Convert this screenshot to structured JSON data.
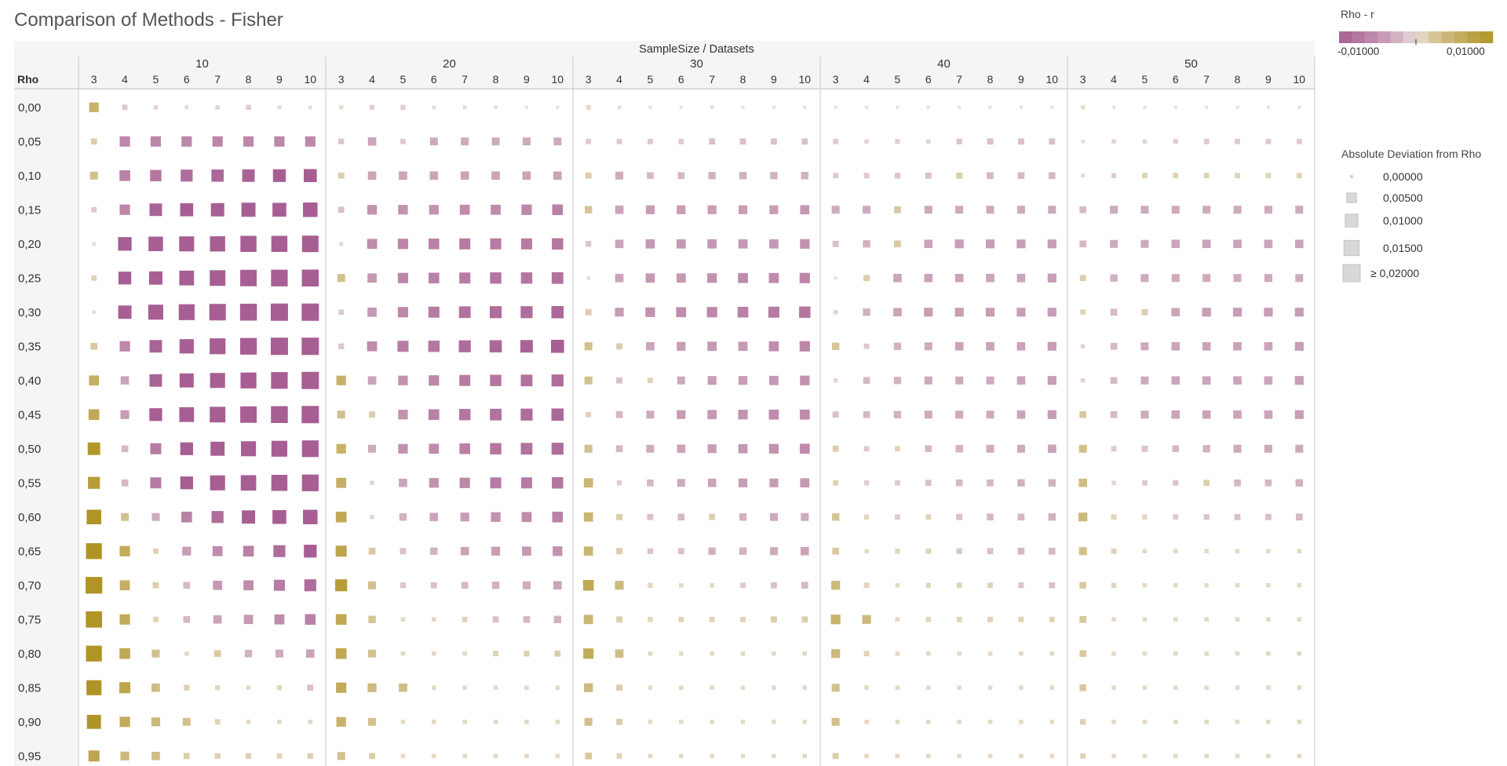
{
  "title": "Comparison of Methods - Fisher",
  "chart_data": {
    "type": "heatmap",
    "title": "Comparison of Methods - Fisher",
    "column_header": "SampleSize  /  Datasets",
    "row_header": "Rho",
    "sample_sizes": [
      "10",
      "20",
      "30",
      "40",
      "50"
    ],
    "datasets": [
      "3",
      "4",
      "5",
      "6",
      "7",
      "8",
      "9",
      "10"
    ],
    "rho": [
      "0,00",
      "0,05",
      "0,10",
      "0,15",
      "0,20",
      "0,25",
      "0,30",
      "0,35",
      "0,40",
      "0,45",
      "0,50",
      "0,55",
      "0,60",
      "0,65",
      "0,70",
      "0,75",
      "0,80",
      "0,85",
      "0,90",
      "0,95"
    ],
    "color_encoding": "Rho - r (signed)",
    "size_encoding": "Absolute Deviation from Rho",
    "note": "Each cell value = Rho - r; square size = |value|",
    "values": [
      [
        0.005,
        -0.001,
        -0.0005,
        -0.0003,
        -0.0005,
        -0.0008,
        -0.0003,
        -0.0002,
        0.0004,
        -0.0007,
        -0.0008,
        -0.0002,
        -0.0003,
        -0.0002,
        -0.0001,
        -0.0001,
        0.0006,
        -0.0002,
        -0.0001,
        -0.0001,
        -0.0002,
        -0.0001,
        -0.0001,
        -0.0001,
        -0.0001,
        -0.0001,
        -0.0001,
        -0.0001,
        -0.0001,
        -0.0001,
        -0.0001,
        -0.0001,
        0.0004,
        -0.0001,
        -0.0001,
        -0.0001,
        -0.0001,
        -0.0001,
        -0.0001,
        -0.0001
      ],
      [
        0.0015,
        -0.006,
        -0.006,
        -0.006,
        -0.006,
        -0.006,
        -0.006,
        -0.006,
        -0.0012,
        -0.0035,
        -0.001,
        -0.003,
        -0.003,
        -0.003,
        -0.003,
        -0.003,
        -0.001,
        -0.001,
        -0.001,
        -0.001,
        -0.0015,
        -0.0015,
        -0.0015,
        -0.0015,
        -0.001,
        -0.0005,
        -0.0007,
        -0.0005,
        -0.0012,
        -0.0015,
        -0.0015,
        -0.0015,
        -0.0002,
        -0.0005,
        -0.0005,
        -0.0007,
        -0.001,
        -0.001,
        -0.001,
        -0.001
      ],
      [
        0.003,
        -0.0065,
        -0.0075,
        -0.0085,
        -0.009,
        -0.0095,
        -0.01,
        -0.0105,
        0.0015,
        -0.0035,
        -0.0035,
        -0.0035,
        -0.0035,
        -0.0035,
        -0.0035,
        -0.0035,
        0.0015,
        -0.003,
        -0.002,
        -0.002,
        -0.0025,
        -0.0025,
        -0.0025,
        -0.0025,
        -0.001,
        -0.001,
        -0.0012,
        -0.0015,
        0.0015,
        -0.002,
        -0.002,
        -0.002,
        -0.0003,
        -0.0008,
        0.001,
        0.001,
        0.001,
        0.001,
        0.001,
        0.001
      ],
      [
        -0.001,
        -0.006,
        -0.0095,
        -0.0105,
        -0.011,
        -0.0125,
        -0.012,
        -0.0135,
        -0.0015,
        -0.005,
        -0.005,
        -0.005,
        -0.0055,
        -0.0055,
        -0.006,
        -0.0065,
        0.0025,
        -0.0035,
        -0.004,
        -0.004,
        -0.004,
        -0.004,
        -0.004,
        -0.0045,
        -0.003,
        -0.003,
        0.002,
        -0.003,
        -0.003,
        -0.003,
        -0.003,
        -0.003,
        -0.002,
        -0.003,
        -0.003,
        -0.003,
        -0.003,
        -0.003,
        -0.003,
        -0.003
      ],
      [
        -0.0002,
        -0.0115,
        -0.0135,
        -0.0145,
        -0.015,
        -0.017,
        -0.017,
        -0.018,
        -0.0003,
        -0.0055,
        -0.006,
        -0.0065,
        -0.007,
        -0.007,
        -0.007,
        -0.0075,
        -0.0012,
        -0.0035,
        -0.0045,
        -0.0045,
        -0.0045,
        -0.0045,
        -0.0045,
        -0.005,
        -0.0015,
        -0.0025,
        0.002,
        -0.0035,
        -0.004,
        -0.004,
        -0.004,
        -0.004,
        -0.002,
        -0.003,
        -0.003,
        -0.0035,
        -0.0035,
        -0.0035,
        -0.0035,
        -0.0035
      ],
      [
        0.001,
        -0.01,
        -0.011,
        -0.014,
        -0.016,
        -0.018,
        -0.0185,
        -0.019,
        0.003,
        -0.0045,
        -0.006,
        -0.0065,
        -0.007,
        -0.0075,
        -0.0075,
        -0.008,
        -0.0002,
        -0.0035,
        -0.0045,
        -0.0045,
        -0.005,
        -0.0055,
        -0.0055,
        -0.006,
        -0.0001,
        0.0015,
        -0.0035,
        -0.0035,
        -0.0035,
        -0.0035,
        -0.0035,
        -0.004,
        0.0015,
        -0.0025,
        -0.003,
        -0.003,
        -0.003,
        -0.003,
        -0.003,
        -0.003
      ],
      [
        -0.0002,
        -0.011,
        -0.0145,
        -0.0165,
        -0.018,
        -0.019,
        -0.02,
        -0.021,
        -0.001,
        -0.0045,
        -0.006,
        -0.007,
        -0.008,
        -0.0085,
        -0.0085,
        -0.009,
        0.0015,
        -0.004,
        -0.005,
        -0.0055,
        -0.006,
        -0.0065,
        -0.007,
        -0.0075,
        -0.0005,
        -0.0025,
        -0.0035,
        -0.004,
        -0.004,
        -0.004,
        -0.004,
        -0.004,
        0.001,
        -0.002,
        0.0015,
        -0.0035,
        -0.004,
        -0.004,
        -0.004,
        -0.004
      ],
      [
        0.002,
        -0.006,
        -0.0095,
        -0.013,
        -0.0165,
        -0.0185,
        -0.0205,
        -0.021,
        -0.0012,
        -0.0055,
        -0.007,
        -0.0075,
        -0.0085,
        -0.009,
        -0.0095,
        -0.0105,
        0.003,
        0.0015,
        -0.0035,
        -0.004,
        -0.0045,
        -0.0045,
        -0.0055,
        -0.006,
        0.0025,
        -0.001,
        -0.0025,
        -0.003,
        -0.0035,
        -0.0035,
        -0.0035,
        -0.004,
        -0.0005,
        -0.002,
        -0.003,
        -0.0035,
        -0.0035,
        -0.0035,
        -0.0035,
        -0.004
      ],
      [
        0.0055,
        -0.0035,
        -0.0095,
        -0.0125,
        -0.0145,
        -0.0165,
        -0.0185,
        -0.02,
        0.005,
        -0.0035,
        -0.005,
        -0.006,
        -0.007,
        -0.0075,
        -0.008,
        -0.0085,
        0.003,
        -0.0015,
        0.001,
        -0.003,
        -0.004,
        -0.004,
        -0.0045,
        -0.005,
        -0.0005,
        -0.002,
        -0.0025,
        -0.003,
        -0.003,
        -0.003,
        -0.0035,
        -0.004,
        -0.0005,
        -0.002,
        -0.003,
        -0.0035,
        -0.0035,
        -0.0035,
        -0.0035,
        -0.004
      ],
      [
        0.0065,
        -0.004,
        -0.01,
        -0.014,
        -0.016,
        -0.018,
        -0.019,
        -0.021,
        0.003,
        0.0015,
        -0.005,
        -0.0065,
        -0.0075,
        -0.008,
        -0.0085,
        -0.009,
        0.001,
        -0.002,
        -0.003,
        -0.004,
        -0.0045,
        -0.005,
        -0.0055,
        -0.0055,
        -0.0015,
        -0.002,
        -0.0025,
        -0.003,
        -0.003,
        -0.003,
        -0.0035,
        -0.004,
        0.002,
        -0.002,
        -0.003,
        -0.0035,
        -0.0035,
        -0.0035,
        -0.0035,
        -0.004
      ],
      [
        0.0095,
        -0.002,
        -0.007,
        -0.01,
        -0.0125,
        -0.0145,
        -0.0165,
        -0.0185,
        0.005,
        -0.003,
        -0.005,
        -0.0055,
        -0.0065,
        -0.0075,
        -0.008,
        -0.0085,
        0.003,
        -0.002,
        -0.003,
        -0.0035,
        -0.004,
        -0.0045,
        -0.005,
        -0.0055,
        0.0015,
        -0.001,
        0.001,
        -0.002,
        -0.0025,
        -0.003,
        -0.003,
        -0.0035,
        0.003,
        -0.001,
        -0.0015,
        -0.002,
        -0.0025,
        -0.003,
        -0.003,
        -0.003
      ],
      [
        0.0085,
        -0.002,
        -0.007,
        -0.01,
        -0.0145,
        -0.0155,
        -0.017,
        -0.0185,
        0.0055,
        -0.0005,
        -0.0035,
        -0.005,
        -0.006,
        -0.007,
        -0.007,
        -0.0075,
        0.0045,
        -0.0008,
        -0.002,
        -0.003,
        -0.0035,
        -0.004,
        -0.004,
        -0.0045,
        0.001,
        -0.0008,
        -0.001,
        -0.0015,
        -0.002,
        -0.002,
        -0.0025,
        -0.0025,
        0.0035,
        -0.0005,
        -0.001,
        -0.0012,
        0.0015,
        -0.002,
        -0.002,
        -0.0025
      ],
      [
        0.0135,
        0.003,
        -0.003,
        -0.0065,
        -0.0085,
        -0.011,
        -0.012,
        -0.0135,
        0.0065,
        -0.0005,
        -0.0025,
        -0.0035,
        -0.004,
        -0.005,
        -0.0055,
        -0.0065,
        0.0045,
        0.0015,
        -0.0015,
        -0.002,
        0.0015,
        -0.0025,
        -0.003,
        -0.003,
        0.0025,
        0.0008,
        -0.001,
        0.001,
        -0.0015,
        -0.002,
        -0.002,
        -0.0025,
        0.004,
        0.001,
        0.0008,
        -0.001,
        -0.0012,
        -0.0015,
        -0.0015,
        -0.002
      ],
      [
        0.0165,
        0.006,
        0.001,
        -0.004,
        -0.0055,
        -0.0065,
        -0.0085,
        -0.01,
        0.007,
        0.002,
        -0.0015,
        -0.0025,
        -0.0035,
        -0.004,
        -0.0045,
        -0.005,
        0.0045,
        0.0015,
        -0.0012,
        -0.0015,
        -0.0025,
        -0.0025,
        -0.003,
        -0.0035,
        0.002,
        0.0005,
        0.0008,
        0.001,
        -0.0012,
        -0.0015,
        -0.002,
        -0.002,
        0.003,
        0.001,
        0.0005,
        0.0005,
        0.0005,
        0.0005,
        0.0005,
        0.0005
      ],
      [
        0.0185,
        0.0055,
        0.0015,
        -0.002,
        -0.0045,
        -0.0055,
        -0.007,
        -0.0085,
        0.0085,
        0.003,
        -0.0012,
        -0.0015,
        -0.002,
        -0.0025,
        -0.003,
        -0.0035,
        0.0065,
        0.004,
        0.0008,
        0.0005,
        0.0005,
        -0.001,
        -0.0015,
        -0.002,
        0.004,
        0.001,
        0.0005,
        0.0008,
        0.001,
        0.001,
        -0.0012,
        -0.0015,
        0.002,
        0.0008,
        0.0005,
        0.0005,
        0.0005,
        0.0005,
        0.0005,
        0.0005
      ],
      [
        0.0175,
        0.006,
        0.001,
        -0.002,
        -0.0035,
        -0.0045,
        -0.0055,
        -0.0065,
        0.0065,
        0.0025,
        0.0005,
        0.0005,
        0.001,
        -0.0015,
        -0.002,
        -0.0025,
        0.0045,
        0.0015,
        0.0008,
        0.001,
        0.001,
        0.001,
        0.0015,
        0.0015,
        0.005,
        0.004,
        0.0005,
        0.0008,
        0.001,
        0.001,
        0.001,
        0.001,
        0.002,
        0.0005,
        0.0005,
        0.0005,
        0.0005,
        0.0005,
        0.0005,
        0.0005
      ],
      [
        0.0165,
        0.0065,
        0.003,
        0.0005,
        0.002,
        -0.0025,
        -0.003,
        -0.0035,
        0.0065,
        0.003,
        0.0005,
        0.0005,
        0.0005,
        0.001,
        0.0012,
        0.0015,
        0.006,
        0.0035,
        0.0005,
        0.0005,
        0.0005,
        0.0005,
        0.0005,
        0.0005,
        0.004,
        0.001,
        0.0005,
        0.0005,
        0.0005,
        0.0005,
        0.0005,
        0.0005,
        0.002,
        0.0005,
        0.0005,
        0.0005,
        0.0005,
        0.0005,
        0.0005,
        0.0005
      ],
      [
        0.0145,
        0.007,
        0.0035,
        0.0012,
        0.0008,
        0.0005,
        0.0008,
        -0.0015,
        0.006,
        0.004,
        0.0035,
        0.0005,
        0.0005,
        0.0005,
        0.0005,
        0.0005,
        0.004,
        0.0015,
        0.0005,
        0.0005,
        0.0005,
        0.0005,
        0.0005,
        0.0005,
        0.003,
        0.0005,
        0.0005,
        0.0005,
        0.0005,
        0.0005,
        0.0005,
        0.0005,
        0.002,
        0.0005,
        0.0005,
        0.0005,
        0.0005,
        0.0005,
        0.0005,
        0.0005
      ],
      [
        0.0125,
        0.006,
        0.004,
        0.003,
        0.001,
        0.0005,
        0.0005,
        0.0005,
        0.005,
        0.003,
        0.0005,
        0.0005,
        0.0005,
        0.0005,
        0.0005,
        0.0005,
        0.003,
        0.0015,
        0.0005,
        0.0005,
        0.0005,
        0.0005,
        0.0005,
        0.0005,
        0.003,
        0.0005,
        0.0005,
        0.0005,
        0.0005,
        0.0005,
        0.0005,
        0.0005,
        0.0012,
        0.0005,
        0.0005,
        0.0005,
        0.0005,
        0.0005,
        0.0005,
        0.0005
      ],
      [
        0.007,
        0.004,
        0.0035,
        0.0015,
        0.0012,
        0.0012,
        0.001,
        0.0012,
        0.003,
        0.0015,
        0.0005,
        0.0005,
        0.0005,
        0.0005,
        0.0005,
        0.0005,
        0.002,
        0.001,
        0.0005,
        0.0005,
        0.0005,
        0.0005,
        0.0005,
        0.0005,
        0.0015,
        0.0005,
        0.0005,
        0.0005,
        0.0005,
        0.0005,
        0.0005,
        0.0005,
        0.001,
        0.0005,
        0.0005,
        0.0005,
        0.0005,
        0.0005,
        0.0005,
        0.0005
      ]
    ],
    "color_legend": {
      "title": "Rho - r",
      "min_label": "-0,01000",
      "max_label": "0,01000",
      "min": -0.01,
      "max": 0.01,
      "negative_color": "#a75f93",
      "positive_color": "#b09425",
      "neutral_color": "#ece3dd"
    },
    "size_legend": {
      "title": "Absolute Deviation from Rho",
      "items": [
        {
          "label": "0,00000",
          "value": 0.0
        },
        {
          "label": "0,00500",
          "value": 0.005
        },
        {
          "label": "0,01000",
          "value": 0.01
        },
        {
          "label": "0,01500",
          "value": 0.015
        },
        {
          "label": "≥ 0,02000",
          "value": 0.02
        }
      ]
    }
  }
}
